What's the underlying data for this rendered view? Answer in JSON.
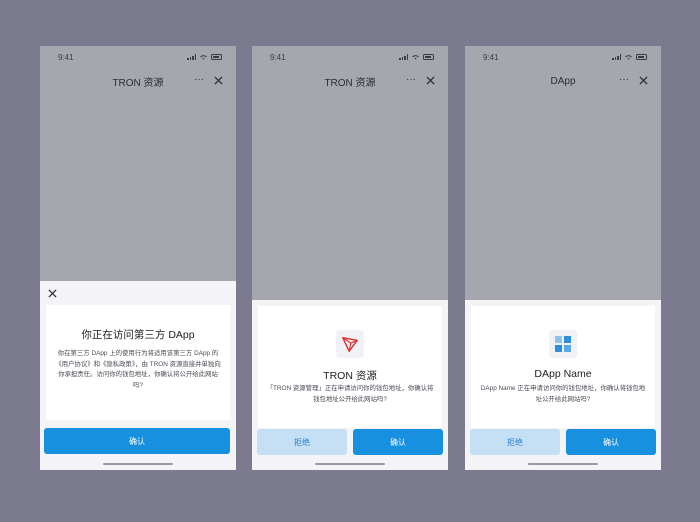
{
  "colors": {
    "background": "#7c7a8f",
    "overlay": "#a6a6af",
    "primary": "#1890e0",
    "secondary": "#c5dff5",
    "tron_red": "#e2302f"
  },
  "screens": [
    {
      "time": "9:41",
      "nav": {
        "title": "TRON 资源",
        "more": "···",
        "close_icon": "close-icon"
      },
      "sheet": {
        "close_icon": "close-icon",
        "title": "你正在访问第三方 DApp",
        "body": "你在第三方 DApp 上的使用行为将适用该第三方 DApp 的《用户协议》和《隐私政策》，由 TRON 资源直接并单独向你承担责任。访问你的钱包地址，你确认将公开给此网站吗?",
        "confirm_label": "确认"
      }
    },
    {
      "time": "9:41",
      "nav": {
        "title": "TRON 资源",
        "more": "···",
        "close_icon": "close-icon"
      },
      "sheet": {
        "icon": "tron-logo-icon",
        "title": "TRON 资源",
        "body": "「TRON 资源管理」正在申请访问你的钱包地址，你确认将钱包地址公开给此网站吗?",
        "reject_label": "拒绝",
        "confirm_label": "确认"
      }
    },
    {
      "time": "9:41",
      "nav": {
        "title": "DApp",
        "more": "···",
        "close_icon": "close-icon"
      },
      "sheet": {
        "icon": "dapp-logo-icon",
        "title": "DApp Name",
        "body": "DApp Name 正在申请访问你的钱包地址，你确认将钱包地址公开给此网站吗?",
        "reject_label": "拒绝",
        "confirm_label": "确认"
      }
    }
  ]
}
